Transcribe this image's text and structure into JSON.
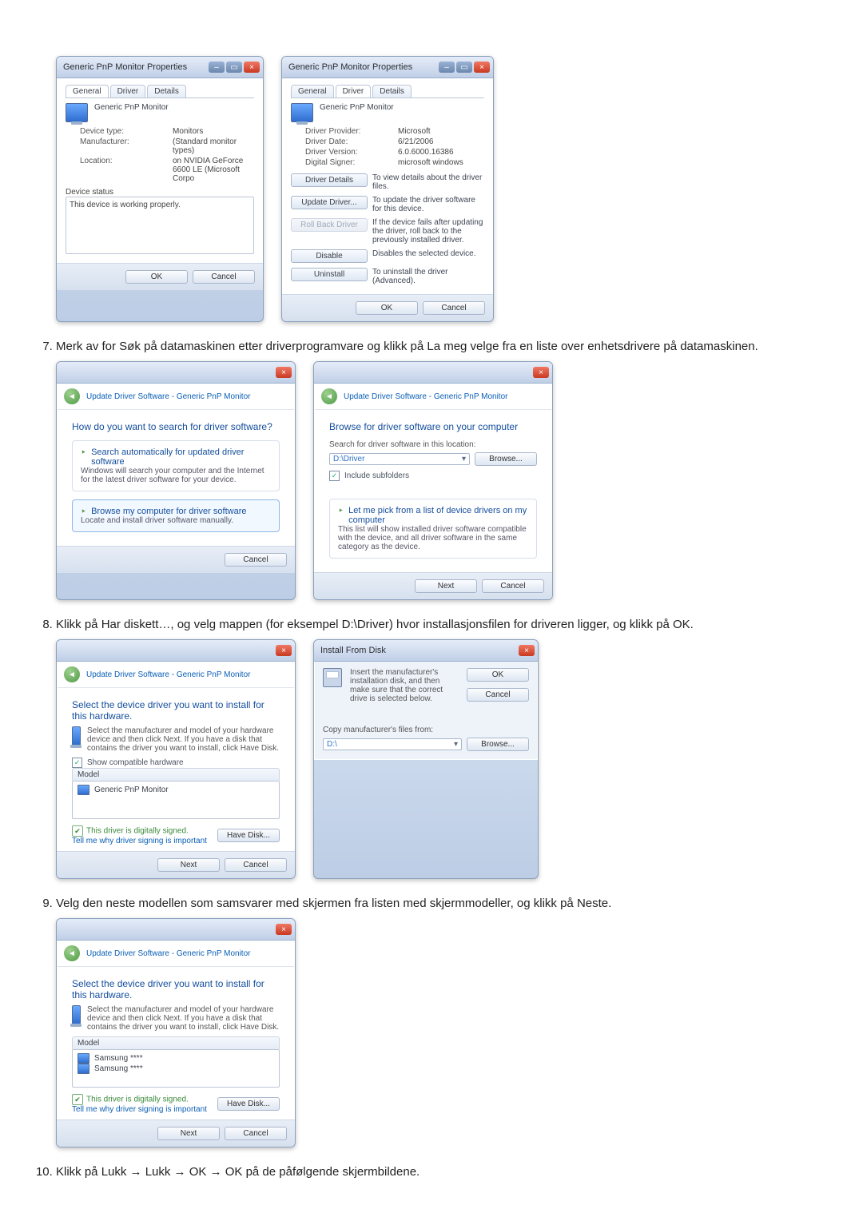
{
  "step7": {
    "num": "7.",
    "text": "Merk av for Søk på datamaskinen etter driverprogramvare og klikk på La meg velge fra en liste over enhetsdrivere på datamaskinen."
  },
  "step8": {
    "num": "8.",
    "text": "Klikk på Har diskett…, og velg mappen (for eksempel D:\\Driver) hvor installasjonsfilen for driveren ligger, og klikk på OK."
  },
  "step9": {
    "num": "9.",
    "text": "Velg den neste modellen som samsvarer med skjermen fra listen med skjermmodeller, og klikk på Neste."
  },
  "step10": {
    "num": "10.",
    "text": "Klikk på Lukk → Lukk → OK → OK på de påfølgende skjermbildene."
  },
  "propsA": {
    "title": "Generic PnP Monitor Properties",
    "tabs": {
      "general": "General",
      "driver": "Driver",
      "details": "Details"
    },
    "header": "Generic PnP Monitor",
    "kv": {
      "devtype_k": "Device type:",
      "devtype_v": "Monitors",
      "mfg_k": "Manufacturer:",
      "mfg_v": "(Standard monitor types)",
      "loc_k": "Location:",
      "loc_v": "on NVIDIA GeForce 6600 LE (Microsoft Corpo"
    },
    "status_label": "Device status",
    "status_text": "This device is working properly.",
    "ok": "OK",
    "cancel": "Cancel"
  },
  "propsB": {
    "title": "Generic PnP Monitor Properties",
    "tabs": {
      "general": "General",
      "driver": "Driver",
      "details": "Details"
    },
    "header": "Generic PnP Monitor",
    "kv": {
      "prov_k": "Driver Provider:",
      "prov_v": "Microsoft",
      "date_k": "Driver Date:",
      "date_v": "6/21/2006",
      "ver_k": "Driver Version:",
      "ver_v": "6.0.6000.16386",
      "sign_k": "Digital Signer:",
      "sign_v": "microsoft windows"
    },
    "btns": {
      "details": "Driver Details",
      "details_d": "To view details about the driver files.",
      "update": "Update Driver...",
      "update_d": "To update the driver software for this device.",
      "roll": "Roll Back Driver",
      "roll_d": "If the device fails after updating the driver, roll back to the previously installed driver.",
      "disable": "Disable",
      "disable_d": "Disables the selected device.",
      "uninst": "Uninstall",
      "uninst_d": "To uninstall the driver (Advanced)."
    },
    "ok": "OK",
    "cancel": "Cancel"
  },
  "wizA": {
    "trail": "Update Driver Software - Generic PnP Monitor",
    "heading": "How do you want to search for driver software?",
    "opt1_t": "Search automatically for updated driver software",
    "opt1_s": "Windows will search your computer and the Internet for the latest driver software for your device.",
    "opt2_t": "Browse my computer for driver software",
    "opt2_s": "Locate and install driver software manually.",
    "cancel": "Cancel"
  },
  "wizB": {
    "trail": "Update Driver Software - Generic PnP Monitor",
    "heading": "Browse for driver software on your computer",
    "searchlbl": "Search for driver software in this location:",
    "path": "D:\\Driver",
    "browse": "Browse...",
    "chk": "Include subfolders",
    "opt_t": "Let me pick from a list of device drivers on my computer",
    "opt_s": "This list will show installed driver software compatible with the device, and all driver software in the same category as the device.",
    "next": "Next",
    "cancel": "Cancel"
  },
  "wizC": {
    "trail": "Update Driver Software - Generic PnP Monitor",
    "heading": "Select the device driver you want to install for this hardware.",
    "hint": "Select the manufacturer and model of your hardware device and then click Next. If you have a disk that contains the driver you want to install, click Have Disk.",
    "compat_chk": "Show compatible hardware",
    "model_hdr": "Model",
    "model_item": "Generic PnP Monitor",
    "signed": "This driver is digitally signed.",
    "tell": "Tell me why driver signing is important",
    "havedisk": "Have Disk...",
    "next": "Next",
    "cancel": "Cancel"
  },
  "dlg": {
    "title": "Install From Disk",
    "msg": "Insert the manufacturer's installation disk, and then make sure that the correct drive is selected below.",
    "ok": "OK",
    "cancel": "Cancel",
    "copylbl": "Copy manufacturer's files from:",
    "path": "D:\\",
    "browse": "Browse..."
  },
  "wizD": {
    "trail": "Update Driver Software - Generic PnP Monitor",
    "heading": "Select the device driver you want to install for this hardware.",
    "hint": "Select the manufacturer and model of your hardware device and then click Next. If you have a disk that contains the driver you want to install, click Have Disk.",
    "model_hdr": "Model",
    "m1": "Samsung ****",
    "m2": "Samsung ****",
    "signed": "This driver is digitally signed.",
    "tell": "Tell me why driver signing is important",
    "havedisk": "Have Disk...",
    "next": "Next",
    "cancel": "Cancel"
  }
}
